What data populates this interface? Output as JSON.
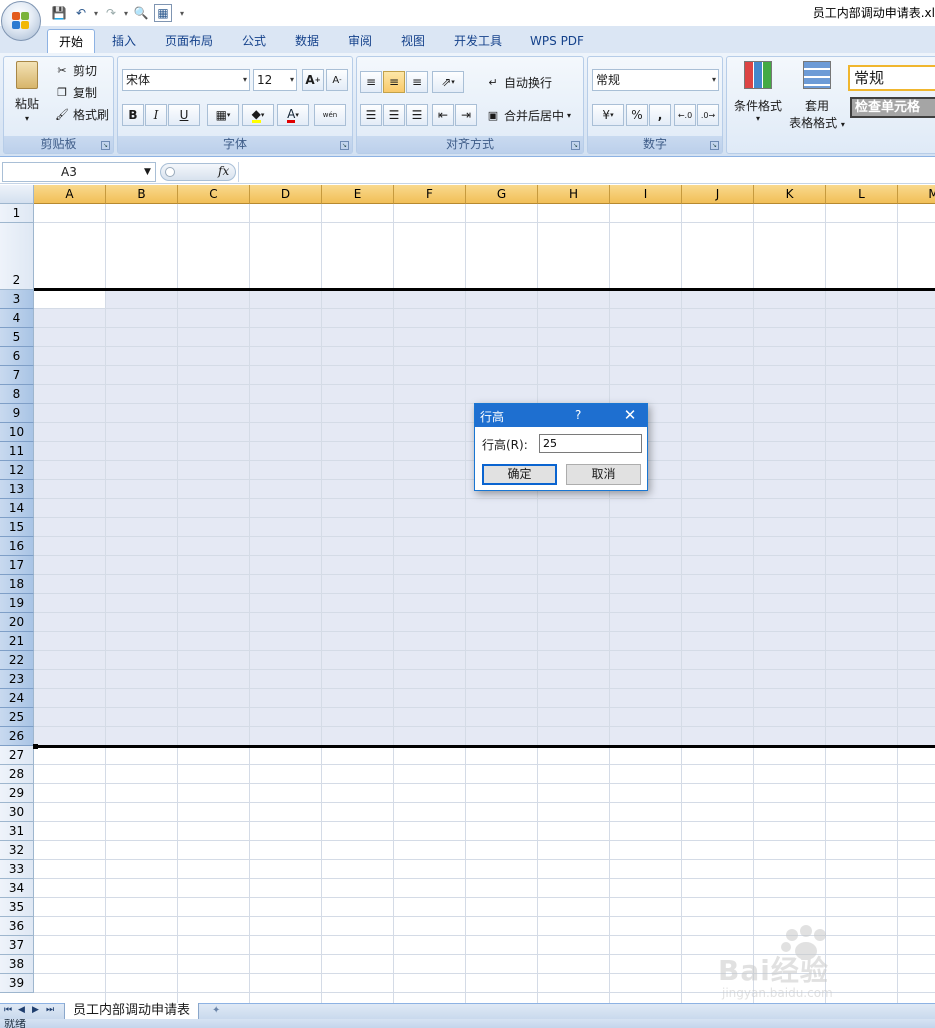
{
  "window": {
    "title": "员工内部调动申请表.xl"
  },
  "ribbon": {
    "tabs": [
      "开始",
      "插入",
      "页面布局",
      "公式",
      "数据",
      "审阅",
      "视图",
      "开发工具",
      "WPS PDF"
    ],
    "active_tab": "开始",
    "clipboard": {
      "paste": "粘贴",
      "cut": "剪切",
      "copy": "复制",
      "format_painter": "格式刷",
      "label": "剪贴板"
    },
    "font": {
      "name": "宋体",
      "size": "12",
      "bold": "B",
      "italic": "I",
      "underline": "U",
      "font_color_glyph": "A",
      "phonetic_glyph": "wén",
      "label": "字体"
    },
    "alignment": {
      "wrap_text": "自动换行",
      "merge_center": "合并后居中",
      "label": "对齐方式"
    },
    "number": {
      "format": "常规",
      "percent": "%",
      "comma": ",",
      "label": "数字"
    },
    "styles": {
      "conditional_format": "条件格式",
      "table_format_1": "套用",
      "table_format_2": "表格格式",
      "style_normal": "常规",
      "check_cell": "检查单元格"
    }
  },
  "formula_bar": {
    "name_box": "A3",
    "fx": "fx",
    "formula": ""
  },
  "sheet": {
    "columns": [
      "A",
      "B",
      "C",
      "D",
      "E",
      "F",
      "G",
      "H",
      "I",
      "J",
      "K",
      "L",
      "M"
    ],
    "rows": [
      "1",
      "2",
      "3",
      "4",
      "5",
      "6",
      "7",
      "8",
      "9",
      "10",
      "11",
      "12",
      "13",
      "14",
      "15",
      "16",
      "17",
      "18",
      "19",
      "20",
      "21",
      "22",
      "23",
      "24",
      "25",
      "26",
      "27",
      "28",
      "29",
      "30",
      "31",
      "32",
      "33",
      "34",
      "35",
      "36",
      "37",
      "38",
      "39"
    ],
    "selected_rows": [
      "3",
      "26"
    ],
    "active_cell": "A3"
  },
  "dialog": {
    "title": "行高",
    "help": "?",
    "field_label": "行高(R):",
    "field_value": "25",
    "ok": "确定",
    "cancel": "取消"
  },
  "sheet_tabs": {
    "active": "员工内部调动申请表"
  },
  "status": {
    "text": "就绪"
  },
  "watermark": {
    "brand": "Bai经验",
    "url": "jingyan.baidu.com"
  }
}
